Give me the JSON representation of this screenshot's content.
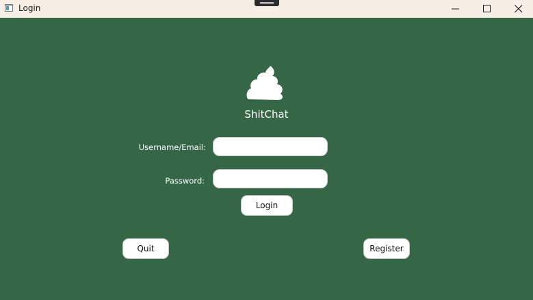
{
  "window": {
    "title": "Login"
  },
  "app": {
    "name": "ShitChat",
    "logo_icon": "pile-icon"
  },
  "form": {
    "username_label": "Username/Email:",
    "username_value": "",
    "password_label": "Password:",
    "password_value": "",
    "login_label": "Login"
  },
  "footer": {
    "quit_label": "Quit",
    "register_label": "Register"
  },
  "colors": {
    "background": "#356746",
    "titlebar": "#f7efe5"
  }
}
